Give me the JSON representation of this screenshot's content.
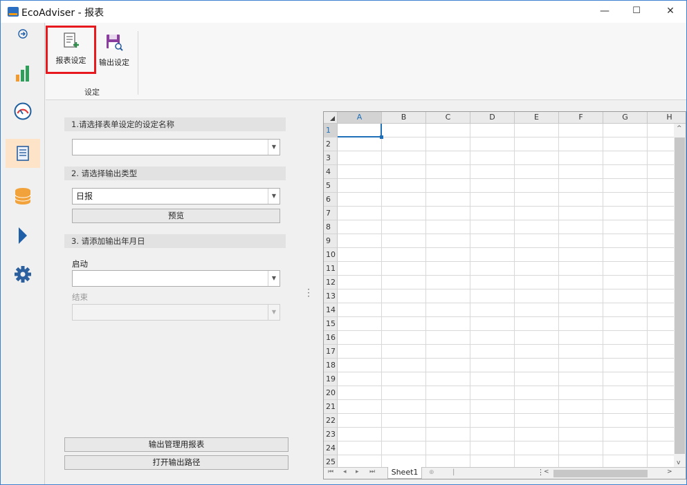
{
  "window": {
    "title": "EcoAdviser - 报表",
    "minimize": "—",
    "maximize": "☐",
    "close": "✕"
  },
  "nav": {
    "items": [
      {
        "name": "expand-icon"
      },
      {
        "name": "chart-icon"
      },
      {
        "name": "gauge-icon"
      },
      {
        "name": "report-icon",
        "active": true
      },
      {
        "name": "database-icon"
      },
      {
        "name": "play-icon"
      },
      {
        "name": "settings-icon"
      }
    ]
  },
  "ribbon": {
    "report_settings": "报表设定",
    "output_settings": "输出设定",
    "group_label": "设定"
  },
  "panel": {
    "section1": "1.请选择表单设定的设定名称",
    "section1_value": "",
    "section2": "2. 请选择输出类型",
    "output_type_value": "日报",
    "preview_button": "预览",
    "section3": "3. 请添加输出年月日",
    "start_label": "启动",
    "start_value": "",
    "end_label": "结束",
    "end_value": "",
    "admin_report_button": "输出管理用报表",
    "open_output_path_button": "打开输出路径"
  },
  "spreadsheet": {
    "columns": [
      "A",
      "B",
      "C",
      "D",
      "E",
      "F",
      "G",
      "H"
    ],
    "rows": [
      "1",
      "2",
      "3",
      "4",
      "5",
      "6",
      "7",
      "8",
      "9",
      "10",
      "11",
      "12",
      "13",
      "14",
      "15",
      "16",
      "17",
      "18",
      "19",
      "20",
      "21",
      "22",
      "23",
      "24",
      "25"
    ],
    "active_cell": "A1",
    "sheet_tab": "Sheet1"
  }
}
